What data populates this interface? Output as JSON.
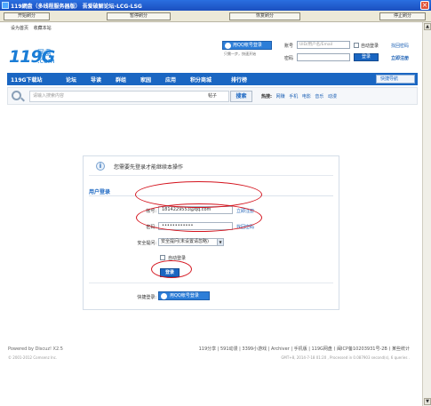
{
  "window": {
    "title": "119網盘（多线程服务器版）  吾爱破解论坛-LCG-LSG",
    "close": "×"
  },
  "toolbar": {
    "start": "开始刷分",
    "pause": "暂停刷分",
    "resume": "恢复刷分",
    "stop": "停止刷分"
  },
  "header": {
    "top_links": [
      "设为首页",
      "收藏本站"
    ],
    "logo": {
      "mark": "119G",
      "brand": "网盘",
      "dotcom": ".com"
    },
    "qq_login": "用QQ帐号登录",
    "qq_hint": "只需一步，快速开始",
    "account_label": "账号",
    "account_placeholder": "UID/用户名/Email",
    "password_label": "密码",
    "auto_login": "自动登录",
    "find_password": "找回密码",
    "login_button": "登录",
    "register": "立即注册"
  },
  "nav": {
    "items": [
      "119G下载站",
      "论坛",
      "导读",
      "群组",
      "家园",
      "应用",
      "积分商城",
      "排行榜"
    ],
    "quick_nav": "快捷导航"
  },
  "search": {
    "placeholder": "请输入搜索内容",
    "type": "帖子",
    "button": "搜索",
    "hot_label": "热搜:",
    "hot_keywords": [
      "网赚",
      "手机",
      "电影",
      "音乐",
      "动漫"
    ]
  },
  "login_panel": {
    "notice": "您需要先登录才能继续本操作",
    "title": "用户登录",
    "account_label": "帐号:",
    "account_value": "1814229553@qq.com",
    "register_link": "立即注册",
    "password_label": "密码:",
    "password_value": "••••••••••••",
    "find_password_link": "找回密码",
    "question_label": "安全提问:",
    "question_value": "安全提问(未设置请忽略)",
    "auto_login": "自动登录",
    "login_button": "登录",
    "quick_login_label": "快捷登录:",
    "qq_button": "用QQ帐号登录"
  },
  "footer": {
    "powered": "Powered by Discuz! X2.5",
    "copyright": "© 2001-2012 Comsenz Inc.",
    "links": "119分享 | 591动漫 | 3399小游戏 | Archiver | 手机版 | 119G网盘 ( 闽ICP备10203931号-2B ) 某些统计",
    "timing": "GMT+8, 2014-7-18 01:20 , Processed in 0.087903 second(s), 6 queries ."
  }
}
